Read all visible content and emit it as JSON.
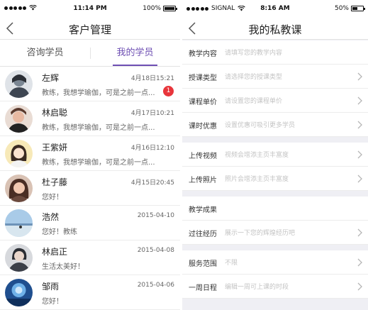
{
  "left_screen": {
    "status_bar": {
      "time": "11:14 PM",
      "battery": "100%"
    },
    "nav": {
      "title": "客户管理"
    },
    "tabs": [
      {
        "label": "咨询学员",
        "active": false
      },
      {
        "label": "我的学员",
        "active": true
      }
    ],
    "students": [
      {
        "name": "左辉",
        "time": "4月18日15:21",
        "message": "教练，我想学瑜伽，可是之前一点...",
        "unread": "1",
        "avatar_color": "#5a6a7a"
      },
      {
        "name": "林启聪",
        "time": "4月17日10:21",
        "message": "教练，我想学瑜伽，可是之前一点...",
        "avatar_color": "#b07a6a"
      },
      {
        "name": "王紫妍",
        "time": "4月16日12:10",
        "message": "教练，我想学瑜伽，可是之前一点...",
        "avatar_color": "#f0dfa8"
      },
      {
        "name": "杜子藤",
        "time": "4月15日20:45",
        "message": "您好！",
        "avatar_color": "#8a5a4a"
      },
      {
        "name": "浩然",
        "time": "2015-04-10",
        "message": "您好！教练",
        "avatar_color": "#8fb3d9"
      },
      {
        "name": "林启正",
        "time": "2015-04-08",
        "message": "生活太美好！",
        "avatar_color": "#4a4f5a"
      },
      {
        "name": "邹雨",
        "time": "2015-04-06",
        "message": "您好！",
        "avatar_color": "#3a6fb0"
      }
    ]
  },
  "right_screen": {
    "status_bar": {
      "carrier": "SIGNAL",
      "time": "8:16 AM",
      "battery": "50%"
    },
    "nav": {
      "title": "我的私教课"
    },
    "groups": [
      [
        {
          "label": "教学内容",
          "placeholder": "请填写您的教学内容",
          "chevron": false
        },
        {
          "label": "授课类型",
          "placeholder": "请选择您的授课类型",
          "chevron": true
        },
        {
          "label": "课程单价",
          "placeholder": "请设置您的课程单价",
          "chevron": true
        },
        {
          "label": "课时优惠",
          "placeholder": "设置优惠可吸引更多学员",
          "chevron": true
        }
      ],
      [
        {
          "label": "上传视频",
          "placeholder": "视频会增添主页丰富度",
          "chevron": true
        },
        {
          "label": "上传照片",
          "placeholder": "照片会增添主页丰富度",
          "chevron": true
        }
      ],
      [
        {
          "label": "教学成果",
          "placeholder": "",
          "chevron": false
        },
        {
          "label": "过往经历",
          "placeholder": "展示一下您的辉煌经历吧",
          "chevron": true
        }
      ],
      [
        {
          "label": "服务范围",
          "placeholder": "不限",
          "chevron": true
        },
        {
          "label": "一周日程",
          "placeholder": "编辑一周可上课的时段",
          "chevron": true
        }
      ]
    ]
  }
}
